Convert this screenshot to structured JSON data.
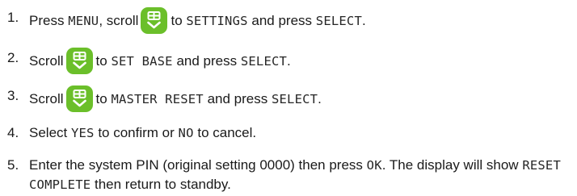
{
  "colors": {
    "key_background": "#6bbf2a",
    "text": "#1a1a1a"
  },
  "icons": {
    "scroll_key": "phonebook-scroll-down-key-icon"
  },
  "steps": [
    {
      "number": "1.",
      "t1": "Press",
      "t2": "MENU",
      "t3": ", scroll",
      "t4": "to",
      "t5": "SETTINGS",
      "t6": "and press",
      "t7": "SELECT",
      "t8": "."
    },
    {
      "number": "2.",
      "t1": "Scroll",
      "t2": "to",
      "t3": "SET BASE",
      "t4": "and press",
      "t5": "SELECT",
      "t6": "."
    },
    {
      "number": "3.",
      "t1": "Scroll",
      "t2": "to",
      "t3": "MASTER RESET",
      "t4": "and press",
      "t5": "SELECT",
      "t6": "."
    },
    {
      "number": "4.",
      "t1": "Select",
      "t2": "YES",
      "t3": "to confirm or",
      "t4": "NO",
      "t5": "to cancel."
    },
    {
      "number": "5.",
      "t1": "Enter the system PIN (original setting 0000) then press",
      "t2": "OK",
      "t3": ". The display will show",
      "t4": "RESET COMPLETE",
      "t5": "then return to standby."
    }
  ]
}
